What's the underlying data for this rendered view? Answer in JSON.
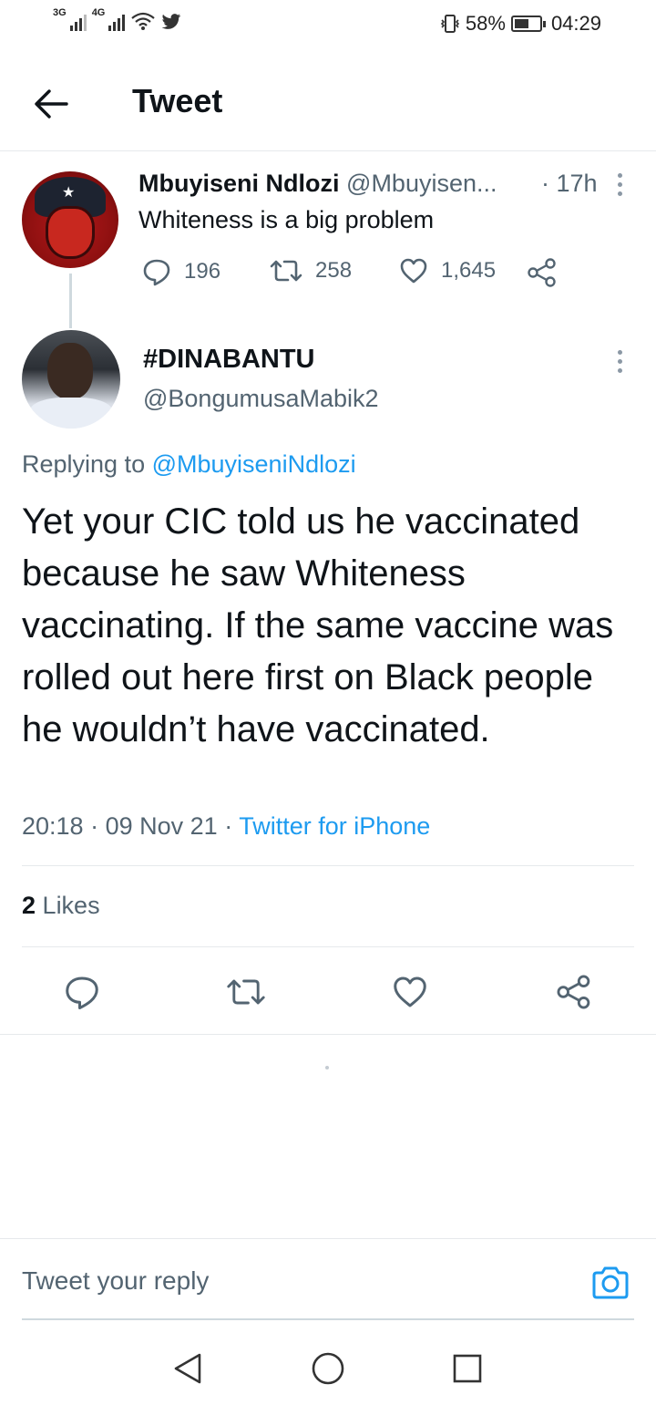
{
  "status_bar": {
    "signal1_label": "3G",
    "signal2_label": "4G",
    "battery_percent": "58%",
    "battery_level": 0.58,
    "time": "04:29",
    "icons": [
      "signal-icon",
      "wifi-icon",
      "twitter-bird-icon",
      "vibrate-icon",
      "battery-icon"
    ]
  },
  "header": {
    "title": "Tweet",
    "back_icon": "arrow-left-icon"
  },
  "parent_tweet": {
    "name": "Mbuyiseni Ndlozi",
    "handle": "@Mbuyisen...",
    "time": "· 17h",
    "text": "Whiteness is a big problem",
    "replies": "196",
    "retweets": "258",
    "likes": "1,645"
  },
  "main_tweet": {
    "name": "#DINABANTU",
    "handle": "@BongumusaMabik2",
    "replying_prefix": "Replying to",
    "replying_handle": "@MbuyiseniNdlozi",
    "text": "Yet your CIC told us he vaccinated because he saw Whiteness vaccinating.  If the same vaccine was rolled out here first on Black people he wouldn’t have vaccinated.",
    "time": "20:18",
    "date": "09 Nov 21",
    "source": "Twitter for iPhone",
    "likes_count": "2",
    "likes_label": "Likes"
  },
  "reply_bar": {
    "placeholder": "Tweet your reply"
  },
  "colors": {
    "accent": "#1d9bf0",
    "text_primary": "#0f1419",
    "text_secondary": "#536471",
    "divider": "#e6e9ec"
  }
}
